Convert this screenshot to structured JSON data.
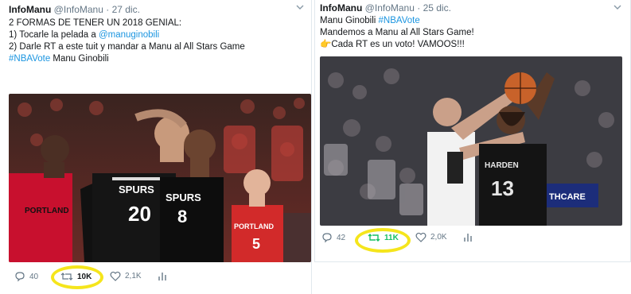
{
  "tweets": [
    {
      "author": {
        "name": "InfoManu",
        "handle": "@InfoManu"
      },
      "separator": "·",
      "date": "27 dic.",
      "lines": [
        {
          "text": "2 FORMAS DE TENER UN 2018 GENIAL:"
        },
        {
          "text": "1) Tocarle la pelada a ",
          "mention": "@manuginobili"
        },
        {
          "text": "2) Darle RT a este tuit y mandar a Manu al All Stars Game"
        },
        {
          "hashtag": "#NBAVote",
          "text": " Manu Ginobili"
        }
      ],
      "photo": {
        "description": "Ginobili and Patty Mills in Spurs black jerseys, Portland player in red behind",
        "jersey_text": [
          "SPURS",
          "20",
          "SPURS",
          "8",
          "PORTLAND",
          "PORTLAND",
          "5"
        ]
      },
      "actions": {
        "reply_count": "40",
        "retweet_count": "10K",
        "like_count": "2,1K"
      },
      "icons": [
        "reply-icon",
        "retweet-icon",
        "like-icon",
        "analytics-icon",
        "chevron-down-icon"
      ]
    },
    {
      "author": {
        "name": "InfoManu",
        "handle": "@InfoManu"
      },
      "separator": "·",
      "date": "25 dic.",
      "lines": [
        {
          "text": "Manu Ginobili ",
          "hashtag": "#NBAVote"
        },
        {
          "text": "Mandemos a Manu al All Stars Game!"
        },
        {
          "emoji": "👉",
          "text": "Cada RT es un voto! VAMOOS!!!"
        }
      ],
      "photo": {
        "description": "Ginobili in white Spurs jersey blocking James Harden in black Rockets jersey",
        "jersey_text": [
          "HARDEN",
          "13",
          "THCARE"
        ]
      },
      "actions": {
        "reply_count": "42",
        "retweet_count": "11K",
        "like_count": "2,0K"
      },
      "icons": [
        "reply-icon",
        "retweet-icon",
        "like-icon",
        "analytics-icon",
        "chevron-down-icon"
      ]
    }
  ],
  "colors": {
    "link": "#1b95e0",
    "meta": "#657786",
    "retweet_active": "#17bf63",
    "highlight": "#f5e51c"
  }
}
